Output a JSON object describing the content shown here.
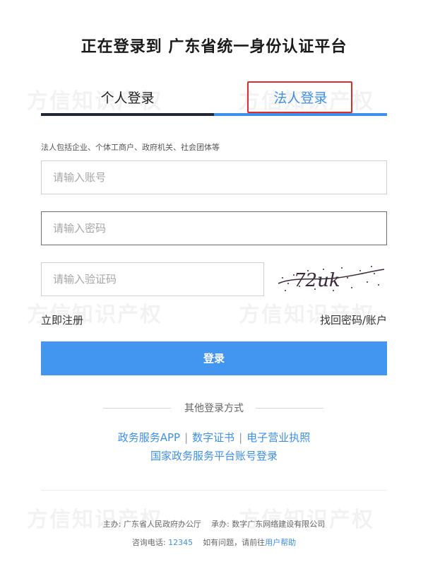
{
  "title": "正在登录到 广东省统一身份认证平台",
  "tabs": {
    "personal": "个人登录",
    "legal": "法人登录"
  },
  "hint": "法人包括企业、个体工商户、政府机关、社会团体等",
  "form": {
    "account_placeholder": "请输入账号",
    "password_placeholder": "请输入密码",
    "captcha_placeholder": "请输入验证码",
    "captcha_text": "72uk"
  },
  "links": {
    "register": "立即注册",
    "recover": "找回密码/账户"
  },
  "login_button": "登录",
  "other_login": {
    "title": "其他登录方式",
    "methods": [
      "政务服务APP",
      "数字证书",
      "电子营业执照"
    ],
    "separator": "|",
    "national": "国家政务服务平台账号登录"
  },
  "footer": {
    "host": "主办: 广东省人民政府办公厅",
    "contractor": "承办: 数字广东网络建设有限公司",
    "phone_label": "咨询电话: ",
    "phone": "12345",
    "question": "如有问题，请前往",
    "help": "用户帮助"
  },
  "watermark": "方信知识产权",
  "colors": {
    "accent": "#3d8fe8",
    "button": "#4396ef",
    "highlight_border": "#e02b2b",
    "tab_underline_dark": "#1f2733"
  }
}
